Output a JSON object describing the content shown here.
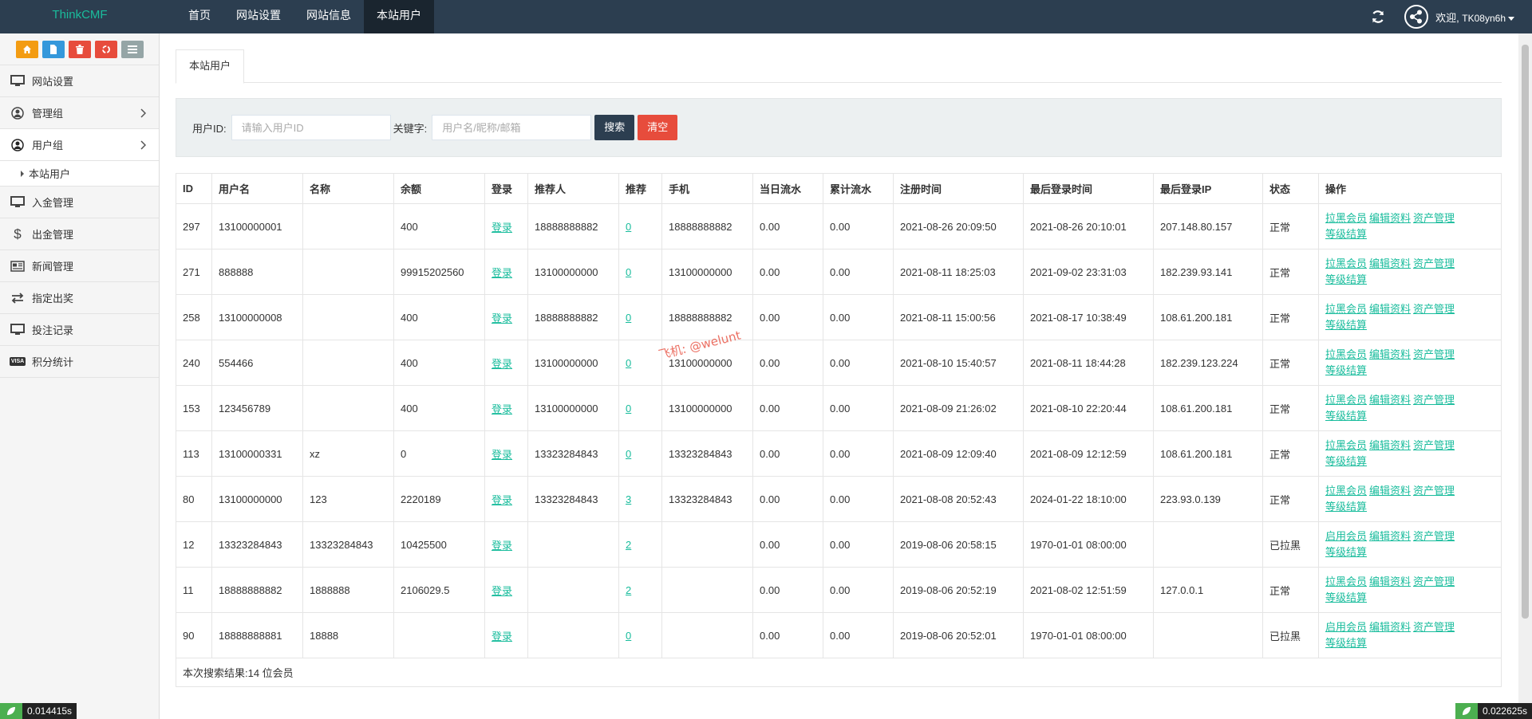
{
  "header": {
    "brand": "ThinkCMF",
    "nav": [
      "首页",
      "网站设置",
      "网站信息",
      "本站用户"
    ],
    "active_nav": 3,
    "welcome": "欢迎, ",
    "username": "TK08yn6h"
  },
  "sidebar": {
    "shortcut_colors": [
      "#f39c12",
      "#3498db",
      "#e74c3c",
      "#e74c3c",
      "#95a5a6"
    ],
    "items": [
      {
        "label": "网站设置",
        "icon": "monitor-icon"
      },
      {
        "label": "管理组",
        "icon": "user-circle-icon",
        "chevron": true
      },
      {
        "label": "用户组",
        "icon": "user-circle-icon",
        "chevron": true,
        "active": true
      },
      {
        "label": "入金管理",
        "icon": "monitor-icon"
      },
      {
        "label": "出金管理",
        "icon": "dollar-icon"
      },
      {
        "label": "新闻管理",
        "icon": "newspaper-icon"
      },
      {
        "label": "指定出奖",
        "icon": "exchange-icon"
      },
      {
        "label": "投注记录",
        "icon": "monitor-icon"
      },
      {
        "label": "积分统计",
        "icon": "visa-icon"
      }
    ],
    "subitem": "本站用户",
    "visa_text": "VISA"
  },
  "main": {
    "tab": "本站用户",
    "filter": {
      "userid_label": "用户ID:",
      "userid_placeholder": "请输入用户ID",
      "keyword_label": "关键字:",
      "keyword_placeholder": "用户名/昵称/邮箱",
      "search_label": "搜索",
      "clear_label": "清空"
    },
    "table": {
      "headers": [
        "ID",
        "用户名",
        "名称",
        "余额",
        "登录",
        "推荐人",
        "推荐",
        "手机",
        "当日流水",
        "累计流水",
        "注册时间",
        "最后登录时间",
        "最后登录IP",
        "状态",
        "操作"
      ],
      "rows": [
        {
          "id": "297",
          "username": "13100000001",
          "name": "",
          "balance": "400",
          "login": "登录",
          "referrer": "18888888882",
          "refs": "0",
          "phone": "18888888882",
          "daily": "0.00",
          "total": "0.00",
          "reg": "2021-08-26 20:09:50",
          "last": "2021-08-26 20:10:01",
          "ip": "207.148.80.157",
          "status": "正常",
          "op1": "拉黑会员",
          "op2": "编辑资料",
          "op3": "资产管理",
          "op4": "等级结算"
        },
        {
          "id": "271",
          "username": "888888",
          "name": "",
          "balance": "99915202560",
          "login": "登录",
          "referrer": "13100000000",
          "refs": "0",
          "phone": "13100000000",
          "daily": "0.00",
          "total": "0.00",
          "reg": "2021-08-11 18:25:03",
          "last": "2021-09-02 23:31:03",
          "ip": "182.239.93.141",
          "status": "正常",
          "op1": "拉黑会员",
          "op2": "编辑资料",
          "op3": "资产管理",
          "op4": "等级结算"
        },
        {
          "id": "258",
          "username": "13100000008",
          "name": "",
          "balance": "400",
          "login": "登录",
          "referrer": "18888888882",
          "refs": "0",
          "phone": "18888888882",
          "daily": "0.00",
          "total": "0.00",
          "reg": "2021-08-11 15:00:56",
          "last": "2021-08-17 10:38:49",
          "ip": "108.61.200.181",
          "status": "正常",
          "op1": "拉黑会员",
          "op2": "编辑资料",
          "op3": "资产管理",
          "op4": "等级结算"
        },
        {
          "id": "240",
          "username": "554466",
          "name": "",
          "balance": "400",
          "login": "登录",
          "referrer": "13100000000",
          "refs": "0",
          "phone": "13100000000",
          "daily": "0.00",
          "total": "0.00",
          "reg": "2021-08-10 15:40:57",
          "last": "2021-08-11 18:44:28",
          "ip": "182.239.123.224",
          "status": "正常",
          "op1": "拉黑会员",
          "op2": "编辑资料",
          "op3": "资产管理",
          "op4": "等级结算"
        },
        {
          "id": "153",
          "username": "123456789",
          "name": "",
          "balance": "400",
          "login": "登录",
          "referrer": "13100000000",
          "refs": "0",
          "phone": "13100000000",
          "daily": "0.00",
          "total": "0.00",
          "reg": "2021-08-09 21:26:02",
          "last": "2021-08-10 22:20:44",
          "ip": "108.61.200.181",
          "status": "正常",
          "op1": "拉黑会员",
          "op2": "编辑资料",
          "op3": "资产管理",
          "op4": "等级结算"
        },
        {
          "id": "113",
          "username": "13100000331",
          "name": "xz",
          "balance": "0",
          "login": "登录",
          "referrer": "13323284843",
          "refs": "0",
          "phone": "13323284843",
          "daily": "0.00",
          "total": "0.00",
          "reg": "2021-08-09 12:09:40",
          "last": "2021-08-09 12:12:59",
          "ip": "108.61.200.181",
          "status": "正常",
          "op1": "拉黑会员",
          "op2": "编辑资料",
          "op3": "资产管理",
          "op4": "等级结算"
        },
        {
          "id": "80",
          "username": "13100000000",
          "name": "123",
          "balance": "2220189",
          "login": "登录",
          "referrer": "13323284843",
          "refs": "3",
          "phone": "13323284843",
          "daily": "0.00",
          "total": "0.00",
          "reg": "2021-08-08 20:52:43",
          "last": "2024-01-22 18:10:00",
          "ip": "223.93.0.139",
          "status": "正常",
          "op1": "拉黑会员",
          "op2": "编辑资料",
          "op3": "资产管理",
          "op4": "等级结算"
        },
        {
          "id": "12",
          "username": "13323284843",
          "name": "13323284843",
          "balance": "10425500",
          "login": "登录",
          "referrer": "",
          "refs": "2",
          "phone": "",
          "daily": "0.00",
          "total": "0.00",
          "reg": "2019-08-06 20:58:15",
          "last": "1970-01-01 08:00:00",
          "ip": "",
          "status": "已拉黑",
          "op1": "启用会员",
          "op2": "编辑资料",
          "op3": "资产管理",
          "op4": "等级结算"
        },
        {
          "id": "11",
          "username": "18888888882",
          "name": "1888888",
          "balance": "2106029.5",
          "login": "登录",
          "referrer": "",
          "refs": "2",
          "phone": "",
          "daily": "0.00",
          "total": "0.00",
          "reg": "2019-08-06 20:52:19",
          "last": "2021-08-02 12:51:59",
          "ip": "127.0.0.1",
          "status": "正常",
          "op1": "拉黑会员",
          "op2": "编辑资料",
          "op3": "资产管理",
          "op4": "等级结算"
        },
        {
          "id": "90",
          "username": "18888888881",
          "name": "18888",
          "balance": "",
          "login": "登录",
          "referrer": "",
          "refs": "0",
          "phone": "",
          "daily": "0.00",
          "total": "0.00",
          "reg": "2019-08-06 20:52:01",
          "last": "1970-01-01 08:00:00",
          "ip": "",
          "status": "已拉黑",
          "op1": "启用会员",
          "op2": "编辑资料",
          "op3": "资产管理",
          "op4": "等级结算"
        }
      ],
      "result_text": "本次搜索结果:14 位会员"
    }
  },
  "timers": {
    "left": "0.014415s",
    "right": "0.022625s"
  },
  "watermark": "飞机: @welunt",
  "colors": {
    "topbar": "#2c3e50",
    "brand": "#1abc9c",
    "link": "#18bc9c",
    "danger": "#e74c3c"
  }
}
